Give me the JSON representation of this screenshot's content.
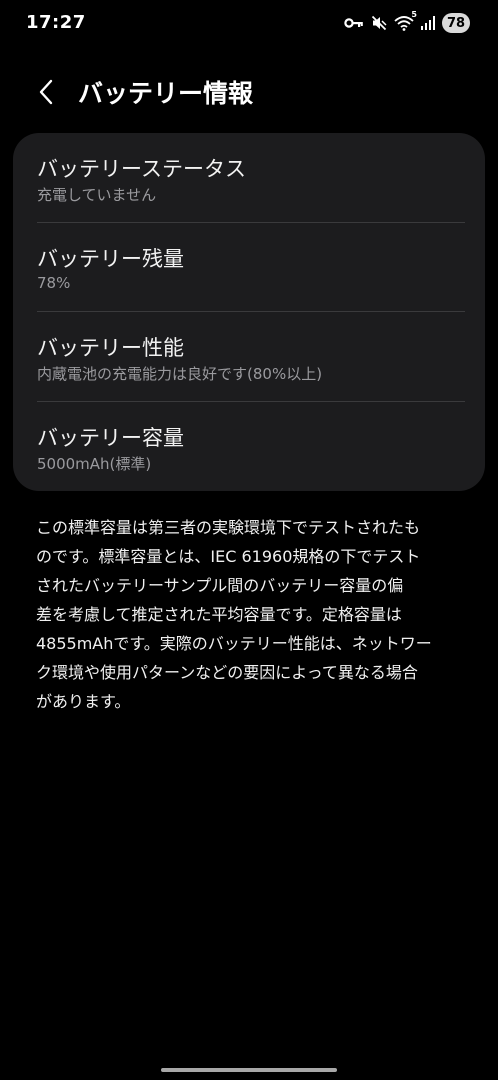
{
  "status_bar": {
    "time": "17:27",
    "icons": [
      "key-icon",
      "mute-icon",
      "wifi-icon",
      "signal-icon"
    ],
    "wifi_label": "5",
    "battery_level": "78"
  },
  "header": {
    "back_icon": "chevron-left-icon",
    "title": "バッテリー情報"
  },
  "battery_info": {
    "items": [
      {
        "title": "バッテリーステータス",
        "value": "充電していません"
      },
      {
        "title": "バッテリー残量",
        "value": "78%"
      },
      {
        "title": "バッテリー性能",
        "value": "内蔵電池の充電能力は良好です(80%以上)"
      },
      {
        "title": "バッテリー容量",
        "value": "5000mAh(標準)"
      }
    ]
  },
  "description": {
    "lines": [
      "この標準容量は第三者の実験環境下でテストされたも",
      "のです。標準容量とは、IEC 61960規格の下でテスト",
      "されたバッテリーサンプル間のバッテリー容量の偏",
      "差を考慮して推定された平均容量です。定格容量は",
      "4855mAhです。実際のバッテリー性能は、ネットワー",
      "ク環境や使用パターンなどの要因によって異なる場合",
      "があります。"
    ]
  },
  "colors": {
    "background": "#000000",
    "card": "#1c1c1e",
    "primary_text": "#f2f2f2",
    "secondary_text": "#9a9a9e",
    "divider": "#3a3a3c"
  }
}
